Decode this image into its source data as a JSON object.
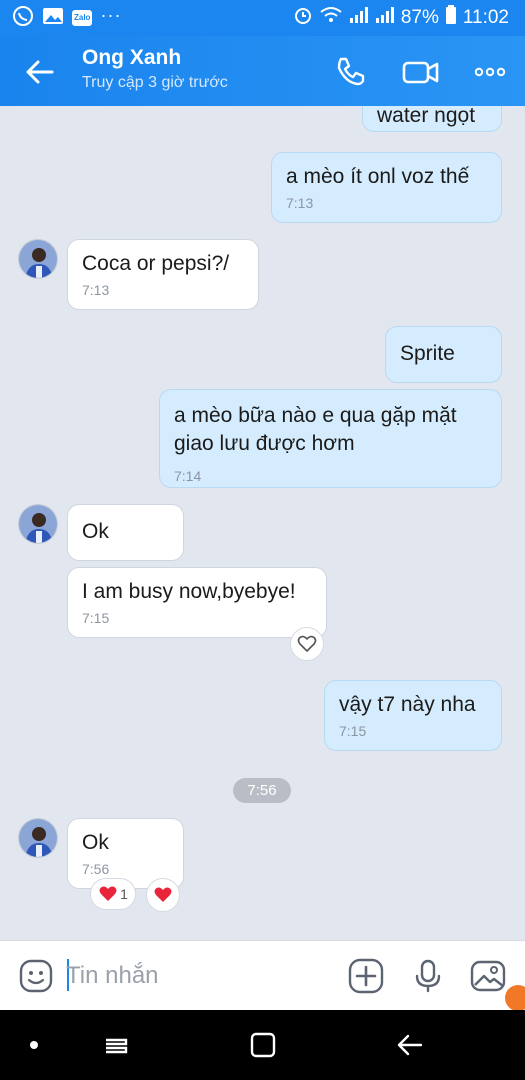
{
  "status_bar": {
    "battery": "87%",
    "time": "11:02",
    "left_icons": [
      "viber-icon",
      "gallery-icon",
      "zalo-icon"
    ],
    "zalo_label": "Zalo",
    "more_label": "···"
  },
  "header": {
    "name": "Ong Xanh",
    "status": "Truy cập 3 giờ trước"
  },
  "messages": [
    {
      "dir": "out",
      "text": "water ngọt",
      "time": ""
    },
    {
      "dir": "out",
      "text": "a mèo ít onl voz thế",
      "time": "7:13"
    },
    {
      "dir": "in",
      "text": "Coca or pepsi?/",
      "time": "7:13"
    },
    {
      "dir": "out",
      "text": "Sprite",
      "time": ""
    },
    {
      "dir": "out",
      "text": "a mèo bữa nào e qua gặp mặt giao lưu được hơm",
      "time": "7:14"
    },
    {
      "dir": "in",
      "text": "Ok",
      "time": ""
    },
    {
      "dir": "in",
      "text": "I am busy now,byebye!",
      "time": "7:15"
    },
    {
      "dir": "out",
      "text": "vậy t7 này nha",
      "time": "7:15"
    },
    {
      "dir": "in",
      "text": "Ok",
      "time": "7:56"
    }
  ],
  "time_separator": "7:56",
  "reactions": {
    "heart_count": "1"
  },
  "composer": {
    "placeholder": "Tin nhắn",
    "value": ""
  },
  "colors": {
    "accent": "#1b86ef",
    "outgoing_bubble": "#d4ecfd",
    "incoming_bubble": "#ffffff",
    "chat_background": "#e2e7ef",
    "heart": "#e8253a"
  }
}
